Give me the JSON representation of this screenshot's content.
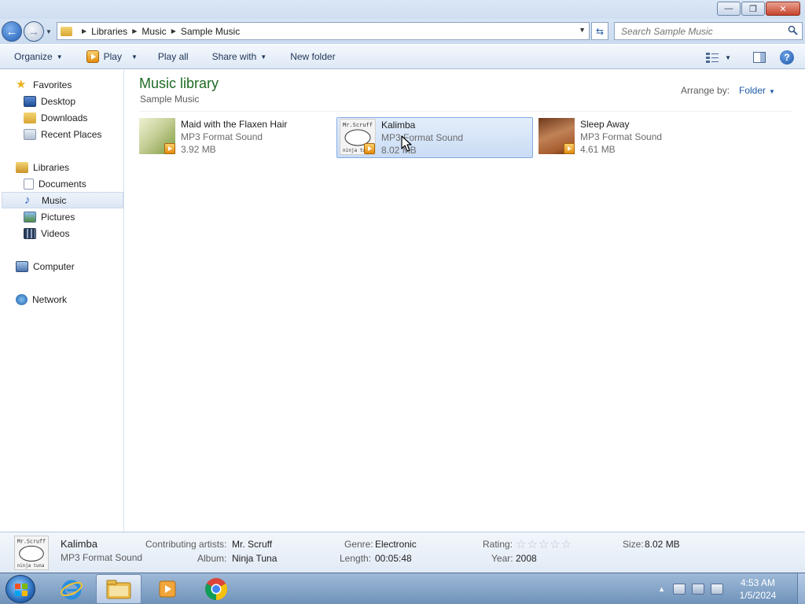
{
  "window": {
    "controls": {
      "minimize": "—",
      "maximize": "❐",
      "close": "✕"
    }
  },
  "address": {
    "crumbs": [
      "Libraries",
      "Music",
      "Sample Music"
    ],
    "search_placeholder": "Search Sample Music"
  },
  "toolbar": {
    "organize": "Organize",
    "play": "Play",
    "play_all": "Play all",
    "share_with": "Share with",
    "new_folder": "New folder",
    "help": "?"
  },
  "nav": {
    "favorites": "Favorites",
    "desktop": "Desktop",
    "downloads": "Downloads",
    "recent_places": "Recent Places",
    "libraries": "Libraries",
    "documents": "Documents",
    "music": "Music",
    "pictures": "Pictures",
    "videos": "Videos",
    "computer": "Computer",
    "network": "Network"
  },
  "library": {
    "title": "Music library",
    "subtitle": "Sample Music",
    "arrange_label": "Arrange by:",
    "arrange_value": "Folder"
  },
  "files": [
    {
      "name": "Maid with the Flaxen Hair",
      "type": "MP3 Format Sound",
      "size": "3.92 MB"
    },
    {
      "name": "Kalimba",
      "type": "MP3 Format Sound",
      "size": "8.02 MB"
    },
    {
      "name": "Sleep Away",
      "type": "MP3 Format Sound",
      "size": "4.61 MB"
    }
  ],
  "details": {
    "name": "Kalimba",
    "type": "MP3 Format Sound",
    "contributing_artists_label": "Contributing artists:",
    "contributing_artists": "Mr. Scruff",
    "album_label": "Album:",
    "album": "Ninja Tuna",
    "genre_label": "Genre:",
    "genre": "Electronic",
    "length_label": "Length:",
    "length": "00:05:48",
    "rating_label": "Rating:",
    "rating_stars": "☆☆☆☆☆",
    "year_label": "Year:",
    "year": "2008",
    "size_label": "Size:",
    "size": "8.02 MB"
  },
  "thumb_text": {
    "kalimba_line1": "Mr.Scruff",
    "kalimba_line2": "ninja tuna"
  },
  "taskbar": {
    "time": "4:53 AM",
    "date": "1/5/2024"
  },
  "colors": {
    "library_title": "#1e6b23",
    "link_blue": "#1e5aa8",
    "selection": "#c9dcf5"
  }
}
